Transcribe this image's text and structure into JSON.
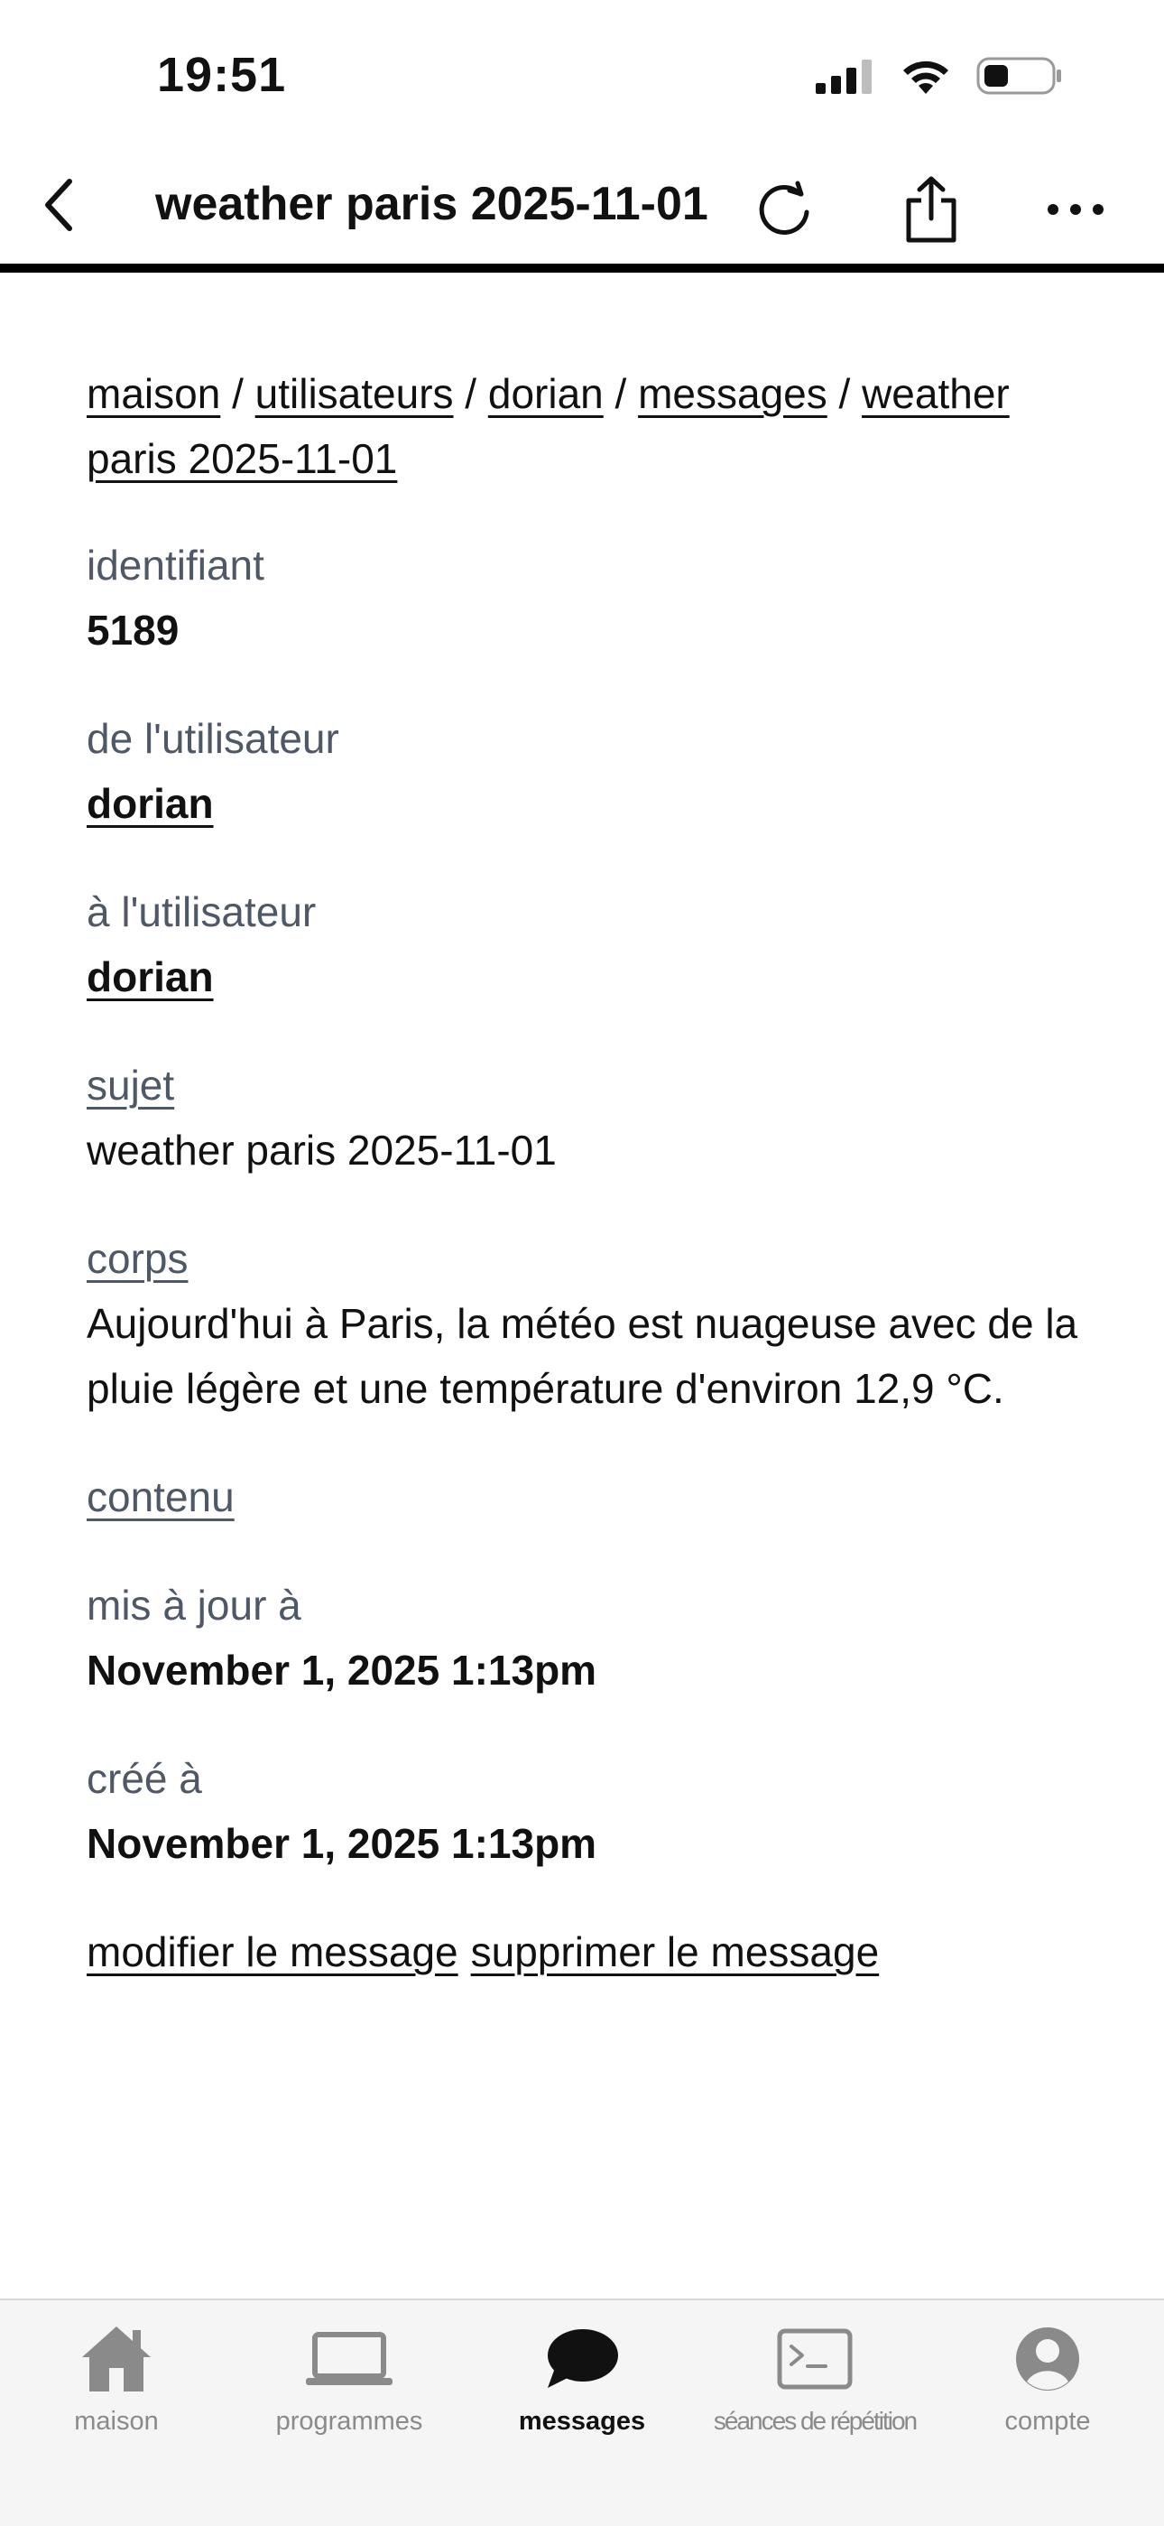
{
  "status_bar": {
    "time": "19:51"
  },
  "nav": {
    "title": "weather paris 2025-11-01"
  },
  "breadcrumb": {
    "items": [
      "maison",
      "utilisateurs",
      "dorian",
      "messages",
      "weather paris 2025-11-01"
    ],
    "separator": "/"
  },
  "fields": {
    "identifiant": {
      "label": "identifiant",
      "value": "5189"
    },
    "from_user": {
      "label": "de l'utilisateur",
      "value": "dorian"
    },
    "to_user": {
      "label": "à l'utilisateur",
      "value": "dorian"
    },
    "subject": {
      "label": "sujet",
      "value": "weather paris 2025-11-01"
    },
    "body": {
      "label": "corps",
      "value": "Aujourd'hui à Paris, la météo est nuageuse avec de la pluie légère et une température d'environ 12,9 °C."
    },
    "content": {
      "label": "contenu"
    },
    "updated_at": {
      "label": "mis à jour à",
      "value": "November 1, 2025 1:13pm"
    },
    "created_at": {
      "label": "créé à",
      "value": "November 1, 2025 1:13pm"
    }
  },
  "actions": {
    "edit": "modifier le message",
    "delete": "supprimer le message"
  },
  "tabs": [
    {
      "label": "maison",
      "icon": "house-icon"
    },
    {
      "label": "programmes",
      "icon": "laptop-icon"
    },
    {
      "label": "messages",
      "icon": "chat-bubble-icon",
      "active": true
    },
    {
      "label": "séances de répétition",
      "icon": "terminal-icon"
    },
    {
      "label": "compte",
      "icon": "person-circle-icon"
    }
  ],
  "colors": {
    "label_gray": "#4f5866",
    "tab_inactive": "#8a8a8a",
    "tab_bar_bg": "#f5f5f5"
  }
}
